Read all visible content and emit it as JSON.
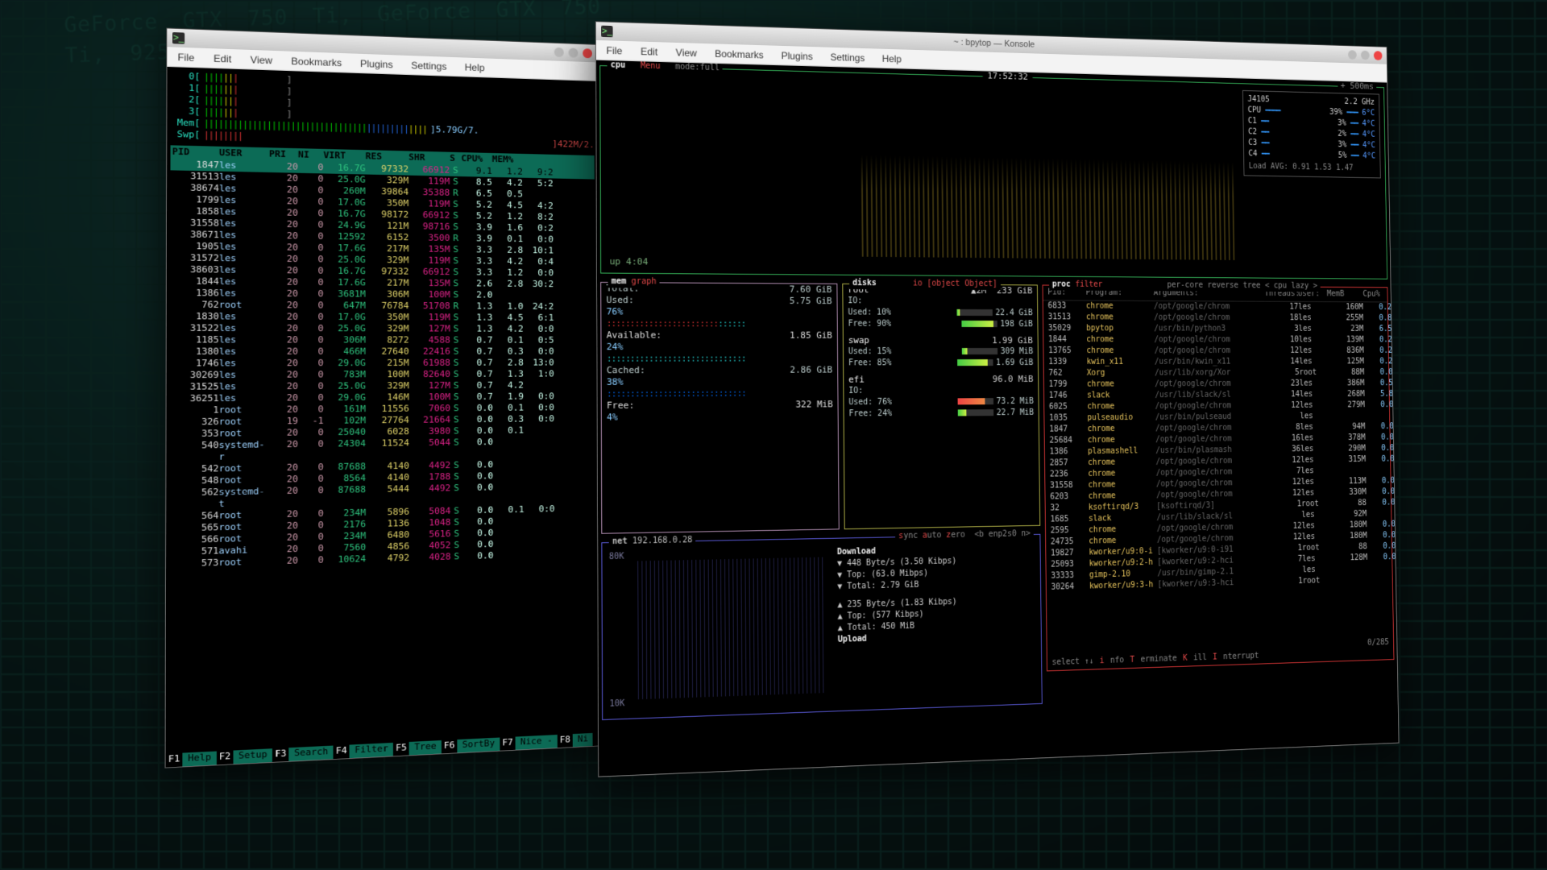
{
  "bpy_window_title": "~ : bpytop — Konsole",
  "menus": [
    "File",
    "Edit",
    "View",
    "Bookmarks",
    "Plugins",
    "Settings",
    "Help"
  ],
  "htop": {
    "cpu_cores": [
      "0",
      "1",
      "2",
      "3"
    ],
    "mem_lbl": "Mem",
    "mem_txt": "5.79G/7.",
    "swp_lbl": "Swp",
    "swp_txt": "422M/2.",
    "header": [
      "PID",
      "USER",
      "PRI",
      "NI",
      "VIRT",
      "RES",
      "SHR",
      "S",
      "CPU%",
      "MEM%",
      ""
    ],
    "rows": [
      {
        "pid": "1847",
        "user": "les",
        "pri": "20",
        "ni": "0",
        "virt": "16.7G",
        "res": "97332",
        "shr": "66912",
        "s": "S",
        "cpu": "9.1",
        "mem": "1.2",
        "t": "9:2",
        "sel": true
      },
      {
        "pid": "31513",
        "user": "les",
        "pri": "20",
        "ni": "0",
        "virt": "25.0G",
        "res": "329M",
        "shr": "119M",
        "s": "S",
        "cpu": "8.5",
        "mem": "4.2",
        "t": "5:2"
      },
      {
        "pid": "38674",
        "user": "les",
        "pri": "20",
        "ni": "0",
        "virt": "260M",
        "res": "39864",
        "shr": "35388",
        "s": "R",
        "cpu": "6.5",
        "mem": "0.5",
        "t": ""
      },
      {
        "pid": "1799",
        "user": "les",
        "pri": "20",
        "ni": "0",
        "virt": "17.0G",
        "res": "350M",
        "shr": "119M",
        "s": "S",
        "cpu": "5.2",
        "mem": "4.5",
        "t": "4:2"
      },
      {
        "pid": "1858",
        "user": "les",
        "pri": "20",
        "ni": "0",
        "virt": "16.7G",
        "res": "98172",
        "shr": "66912",
        "s": "S",
        "cpu": "5.2",
        "mem": "1.2",
        "t": "8:2"
      },
      {
        "pid": "31558",
        "user": "les",
        "pri": "20",
        "ni": "0",
        "virt": "24.9G",
        "res": "121M",
        "shr": "98716",
        "s": "S",
        "cpu": "3.9",
        "mem": "1.6",
        "t": "0:2"
      },
      {
        "pid": "38671",
        "user": "les",
        "pri": "20",
        "ni": "0",
        "virt": "12592",
        "res": "6152",
        "shr": "3500",
        "s": "R",
        "cpu": "3.9",
        "mem": "0.1",
        "t": "0:0"
      },
      {
        "pid": "1905",
        "user": "les",
        "pri": "20",
        "ni": "0",
        "virt": "17.6G",
        "res": "217M",
        "shr": "135M",
        "s": "S",
        "cpu": "3.3",
        "mem": "2.8",
        "t": "10:1"
      },
      {
        "pid": "31572",
        "user": "les",
        "pri": "20",
        "ni": "0",
        "virt": "25.0G",
        "res": "329M",
        "shr": "119M",
        "s": "S",
        "cpu": "3.3",
        "mem": "4.2",
        "t": "0:4"
      },
      {
        "pid": "38603",
        "user": "les",
        "pri": "20",
        "ni": "0",
        "virt": "16.7G",
        "res": "97332",
        "shr": "66912",
        "s": "S",
        "cpu": "3.3",
        "mem": "1.2",
        "t": "0:0"
      },
      {
        "pid": "1844",
        "user": "les",
        "pri": "20",
        "ni": "0",
        "virt": "17.6G",
        "res": "217M",
        "shr": "135M",
        "s": "S",
        "cpu": "2.6",
        "mem": "2.8",
        "t": "30:2"
      },
      {
        "pid": "1386",
        "user": "les",
        "pri": "20",
        "ni": "0",
        "virt": "3681M",
        "res": "306M",
        "shr": "100M",
        "s": "S",
        "cpu": "2.0",
        "mem": "",
        "t": ""
      },
      {
        "pid": "762",
        "user": "root",
        "pri": "20",
        "ni": "0",
        "virt": "647M",
        "res": "76784",
        "shr": "51708",
        "s": "R",
        "cpu": "1.3",
        "mem": "1.0",
        "t": "24:2"
      },
      {
        "pid": "1830",
        "user": "les",
        "pri": "20",
        "ni": "0",
        "virt": "17.0G",
        "res": "350M",
        "shr": "119M",
        "s": "S",
        "cpu": "1.3",
        "mem": "4.5",
        "t": "6:1"
      },
      {
        "pid": "31522",
        "user": "les",
        "pri": "20",
        "ni": "0",
        "virt": "25.0G",
        "res": "329M",
        "shr": "127M",
        "s": "S",
        "cpu": "1.3",
        "mem": "4.2",
        "t": "0:0"
      },
      {
        "pid": "1185",
        "user": "les",
        "pri": "20",
        "ni": "0",
        "virt": "306M",
        "res": "8272",
        "shr": "4588",
        "s": "S",
        "cpu": "0.7",
        "mem": "0.1",
        "t": "0:5"
      },
      {
        "pid": "1380",
        "user": "les",
        "pri": "20",
        "ni": "0",
        "virt": "466M",
        "res": "27640",
        "shr": "22416",
        "s": "S",
        "cpu": "0.7",
        "mem": "0.3",
        "t": "0:0"
      },
      {
        "pid": "1746",
        "user": "les",
        "pri": "20",
        "ni": "0",
        "virt": "29.0G",
        "res": "215M",
        "shr": "61988",
        "s": "S",
        "cpu": "0.7",
        "mem": "2.8",
        "t": "13:0"
      },
      {
        "pid": "30269",
        "user": "les",
        "pri": "20",
        "ni": "0",
        "virt": "783M",
        "res": "100M",
        "shr": "82640",
        "s": "S",
        "cpu": "0.7",
        "mem": "1.3",
        "t": "1:0"
      },
      {
        "pid": "31525",
        "user": "les",
        "pri": "20",
        "ni": "0",
        "virt": "25.0G",
        "res": "329M",
        "shr": "127M",
        "s": "S",
        "cpu": "0.7",
        "mem": "4.2",
        "t": ""
      },
      {
        "pid": "36251",
        "user": "les",
        "pri": "20",
        "ni": "0",
        "virt": "29.0G",
        "res": "146M",
        "shr": "100M",
        "s": "S",
        "cpu": "0.7",
        "mem": "1.9",
        "t": "0:0"
      },
      {
        "pid": "1",
        "user": "root",
        "pri": "20",
        "ni": "0",
        "virt": "161M",
        "res": "11556",
        "shr": "7060",
        "s": "S",
        "cpu": "0.0",
        "mem": "0.1",
        "t": "0:0"
      },
      {
        "pid": "326",
        "user": "root",
        "pri": "19",
        "ni": "-1",
        "virt": "102M",
        "res": "27764",
        "shr": "21664",
        "s": "S",
        "cpu": "0.0",
        "mem": "0.3",
        "t": "0:0"
      },
      {
        "pid": "353",
        "user": "root",
        "pri": "20",
        "ni": "0",
        "virt": "25040",
        "res": "6028",
        "shr": "3980",
        "s": "S",
        "cpu": "0.0",
        "mem": "0.1",
        "t": ""
      },
      {
        "pid": "540",
        "user": "systemd-r",
        "pri": "20",
        "ni": "0",
        "virt": "24304",
        "res": "11524",
        "shr": "5044",
        "s": "S",
        "cpu": "0.0",
        "mem": "",
        "t": ""
      },
      {
        "pid": "542",
        "user": "root",
        "pri": "20",
        "ni": "0",
        "virt": "87688",
        "res": "4140",
        "shr": "4492",
        "s": "S",
        "cpu": "0.0",
        "mem": "",
        "t": ""
      },
      {
        "pid": "548",
        "user": "root",
        "pri": "20",
        "ni": "0",
        "virt": "8564",
        "res": "4140",
        "shr": "1788",
        "s": "S",
        "cpu": "0.0",
        "mem": "",
        "t": ""
      },
      {
        "pid": "562",
        "user": "systemd-t",
        "pri": "20",
        "ni": "0",
        "virt": "87688",
        "res": "5444",
        "shr": "4492",
        "s": "S",
        "cpu": "0.0",
        "mem": "",
        "t": ""
      },
      {
        "pid": "564",
        "user": "root",
        "pri": "20",
        "ni": "0",
        "virt": "234M",
        "res": "5896",
        "shr": "5084",
        "s": "S",
        "cpu": "0.0",
        "mem": "0.1",
        "t": "0:0"
      },
      {
        "pid": "565",
        "user": "root",
        "pri": "20",
        "ni": "0",
        "virt": "2176",
        "res": "1136",
        "shr": "1048",
        "s": "S",
        "cpu": "0.0",
        "mem": "",
        "t": ""
      },
      {
        "pid": "566",
        "user": "root",
        "pri": "20",
        "ni": "0",
        "virt": "234M",
        "res": "6480",
        "shr": "5616",
        "s": "S",
        "cpu": "0.0",
        "mem": "",
        "t": ""
      },
      {
        "pid": "571",
        "user": "avahi",
        "pri": "20",
        "ni": "0",
        "virt": "7560",
        "res": "4856",
        "shr": "4052",
        "s": "S",
        "cpu": "0.0",
        "mem": "",
        "t": ""
      },
      {
        "pid": "573",
        "user": "root",
        "pri": "20",
        "ni": "0",
        "virt": "10624",
        "res": "4792",
        "shr": "4028",
        "s": "S",
        "cpu": "0.0",
        "mem": "",
        "t": ""
      }
    ],
    "footer": [
      [
        "F1",
        "Help"
      ],
      [
        "F2",
        "Setup"
      ],
      [
        "F3",
        "Search"
      ],
      [
        "F4",
        "Filter"
      ],
      [
        "F5",
        "Tree"
      ],
      [
        "F6",
        "SortBy"
      ],
      [
        "F7",
        "Nice -"
      ],
      [
        "F8",
        "Ni"
      ]
    ]
  },
  "bpy": {
    "cpu": {
      "label": "cpu",
      "menu": "Menu",
      "mode": "mode:full",
      "clock": "17:52:32",
      "rate": "+ 500ms",
      "model": "J4105",
      "freq": "2.2 GHz",
      "total_pct": "39%",
      "total_temp": "6°C",
      "cores": [
        [
          "C1",
          "3%",
          "4°C"
        ],
        [
          "C2",
          "2%",
          "4°C"
        ],
        [
          "C3",
          "3%",
          "4°C"
        ],
        [
          "C4",
          "5%",
          "4°C"
        ]
      ],
      "loadavg": "Load AVG:  0.91   1.53   1.47",
      "uptime": "up 4:04"
    },
    "mem": {
      "lbl": "mem",
      "graph": "graph",
      "total": [
        "Total:",
        "7.60 GiB"
      ],
      "used": [
        "Used:",
        "5.75 GiB"
      ],
      "used_pct": "76%",
      "avail": [
        "Available:",
        "1.85 GiB"
      ],
      "avail_pct": "24%",
      "cached": [
        "Cached:",
        "2.86 GiB"
      ],
      "cached_pct": "38%",
      "free": [
        "Free:",
        "322 MiB"
      ],
      "free_pct": "4%"
    },
    "disks": {
      "lbl": "disks",
      "io": "io",
      "swap": {
        "name": "swap",
        "total": "1.99 GiB",
        "used": [
          "Used: 15%",
          "309 MiB"
        ],
        "free": [
          "Free: 85%",
          "1.69 GiB"
        ]
      },
      "root": {
        "name": "root",
        "sym": "▲2M",
        "total": "233 GiB",
        "io": "IO:",
        "used": [
          "Used: 10%",
          "22.4 GiB"
        ],
        "free": [
          "Free: 90%",
          "198 GiB"
        ]
      },
      "efi": {
        "name": "efi",
        "total": "96.0 MiB",
        "io": "IO:",
        "used": [
          "Used: 76%",
          "73.2 MiB"
        ],
        "free": [
          "Free: 24%",
          "22.7 MiB"
        ]
      }
    },
    "proc": {
      "lbl": "proc",
      "filter": "filter",
      "opts": "per-core  reverse  tree  < cpu lazy >",
      "hdr": [
        "Pid:",
        "Program:",
        "Arguments:",
        "Threads:",
        "User:",
        "MemB",
        "Cpu%"
      ],
      "rows": [
        [
          "6833",
          "chrome",
          "/opt/google/chrom",
          "17",
          "les",
          "160M",
          "0.2"
        ],
        [
          "31513",
          "chrome",
          "/opt/google/chrom",
          "18",
          "les",
          "255M",
          "0.8"
        ],
        [
          "35029",
          "bpytop",
          "/usr/bin/python3",
          "3",
          "les",
          "23M",
          "6.5"
        ],
        [
          "1844",
          "chrome",
          "/opt/google/chrom",
          "10",
          "les",
          "139M",
          "0.2"
        ],
        [
          "13765",
          "chrome",
          "/opt/google/chrom",
          "12",
          "les",
          "836M",
          "0.2"
        ],
        [
          "1339",
          "kwin_x11",
          "/usr/bin/kwin_x11",
          "14",
          "les",
          "125M",
          "0.2"
        ],
        [
          "762",
          "Xorg",
          "/usr/lib/xorg/Xor",
          "5",
          "root",
          "88M",
          "0.0"
        ],
        [
          "1799",
          "chrome",
          "/opt/google/chrom",
          "23",
          "les",
          "386M",
          "0.5"
        ],
        [
          "1746",
          "slack",
          "/usr/lib/slack/sl",
          "14",
          "les",
          "268M",
          "5.8"
        ],
        [
          "6025",
          "chrome",
          "/opt/google/chrom",
          "12",
          "les",
          "279M",
          "0.0"
        ],
        [
          "1035",
          "pulseaudio",
          "/usr/bin/pulseaud",
          "",
          "les",
          "",
          ""
        ],
        [
          "1847",
          "chrome",
          "/opt/google/chrom",
          "8",
          "les",
          "94M",
          "0.0"
        ],
        [
          "25684",
          "chrome",
          "/opt/google/chrom",
          "16",
          "les",
          "378M",
          "0.0"
        ],
        [
          "1386",
          "plasmashell",
          "/usr/bin/plasmash",
          "36",
          "les",
          "290M",
          "0.0"
        ],
        [
          "2857",
          "chrome",
          "/opt/google/chrom",
          "12",
          "les",
          "315M",
          "0.0"
        ],
        [
          "2236",
          "chrome",
          "/opt/google/chrom",
          "7",
          "les",
          "",
          ""
        ],
        [
          "31558",
          "chrome",
          "/opt/google/chrom",
          "12",
          "les",
          "113M",
          "0.0"
        ],
        [
          "6203",
          "chrome",
          "/opt/google/chrom",
          "12",
          "les",
          "330M",
          "0.0"
        ],
        [
          "32",
          "ksoftirqd/3",
          "[ksoftirqd/3]",
          "1",
          "root",
          "88",
          "0.0"
        ],
        [
          "1685",
          "slack",
          "/usr/lib/slack/sl",
          "",
          "les",
          "92M",
          ""
        ],
        [
          "2595",
          "chrome",
          "/opt/google/chrom",
          "12",
          "les",
          "180M",
          "0.0"
        ],
        [
          "24735",
          "chrome",
          "/opt/google/chrom",
          "12",
          "les",
          "180M",
          "0.0"
        ],
        [
          "19827",
          "kworker/u9:0-i",
          "[kworker/u9:0-i91",
          "1",
          "root",
          "88",
          "0.0"
        ],
        [
          "25093",
          "kworker/u9:2-h",
          "[kworker/u9:2-hci",
          "7",
          "les",
          "128M",
          "0.0"
        ],
        [
          "33333",
          "gimp-2.10",
          "/usr/bin/gimp-2.1",
          "",
          "les",
          "",
          ""
        ],
        [
          "30264",
          "kworker/u9:3-h",
          "[kworker/u9:3-hci",
          "1",
          "root",
          "",
          ""
        ]
      ],
      "page": "0/285",
      "footer": "select ↑↓  info  Terminate  Kill  Interrupt"
    },
    "net": {
      "lbl": "net",
      "ip": "192.168.0.28",
      "opts": "sync  auto  zero  <b enp2s0 n>",
      "scale_top": "80K",
      "scale_bot": "10K",
      "dl_title": "Download",
      "dl": [
        "▼ 448 Byte/s  (3.50 Kibps)",
        "▼ Top:        (63.0 Mibps)",
        "▼ Total:       2.79 GiB"
      ],
      "ul_title": "Upload",
      "ul": [
        "▲ 235 Byte/s  (1.83 Kibps)",
        "▲ Top:        (577 Kibps)",
        "▲ Total:       450 MiB"
      ]
    }
  }
}
